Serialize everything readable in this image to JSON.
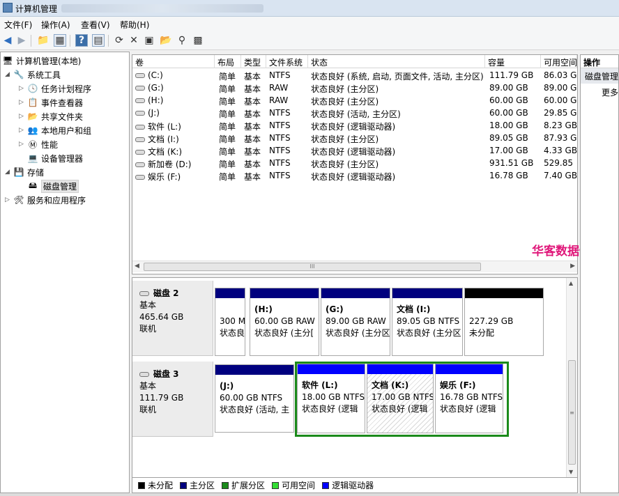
{
  "window": {
    "title": "计算机管理"
  },
  "menu": [
    "文件(F)",
    "操作(A)",
    "查看(V)",
    "帮助(H)"
  ],
  "toolbar_icons": [
    "back-arrow-icon",
    "forward-arrow-icon",
    "up-folder-icon",
    "console-tree-icon",
    "help-icon",
    "show-pane-icon",
    "refresh-icon",
    "delete-icon",
    "properties-icon",
    "open-icon",
    "search-icon",
    "export-icon"
  ],
  "tree": {
    "root": "计算机管理(本地)",
    "system_tools": "系统工具",
    "task_scheduler": "任务计划程序",
    "event_viewer": "事件查看器",
    "shared_folders": "共享文件夹",
    "local_users": "本地用户和组",
    "performance": "性能",
    "device_manager": "设备管理器",
    "storage": "存储",
    "disk_management": "磁盘管理",
    "services_apps": "服务和应用程序"
  },
  "volumes": {
    "columns": [
      "卷",
      "布局",
      "类型",
      "文件系统",
      "状态",
      "容量",
      "可用空间"
    ],
    "rows": [
      [
        "(C:)",
        "简单",
        "基本",
        "NTFS",
        "状态良好 (系统, 启动, 页面文件, 活动, 主分区)",
        "111.79 GB",
        "86.03 G"
      ],
      [
        "(G:)",
        "简单",
        "基本",
        "RAW",
        "状态良好 (主分区)",
        "89.00 GB",
        "89.00 G"
      ],
      [
        "(H:)",
        "简单",
        "基本",
        "RAW",
        "状态良好 (主分区)",
        "60.00 GB",
        "60.00 G"
      ],
      [
        "(J:)",
        "简单",
        "基本",
        "NTFS",
        "状态良好 (活动, 主分区)",
        "60.00 GB",
        "29.85 G"
      ],
      [
        "软件 (L:)",
        "简单",
        "基本",
        "NTFS",
        "状态良好 (逻辑驱动器)",
        "18.00 GB",
        "8.23 GB"
      ],
      [
        "文档 (I:)",
        "简单",
        "基本",
        "NTFS",
        "状态良好 (主分区)",
        "89.05 GB",
        "87.93 G"
      ],
      [
        "文档 (K:)",
        "简单",
        "基本",
        "NTFS",
        "状态良好 (逻辑驱动器)",
        "17.00 GB",
        "4.33 GB"
      ],
      [
        "新加卷 (D:)",
        "简单",
        "基本",
        "NTFS",
        "状态良好 (主分区)",
        "931.51 GB",
        "529.85 "
      ],
      [
        "娱乐 (F:)",
        "简单",
        "基本",
        "NTFS",
        "状态良好 (逻辑驱动器)",
        "16.78 GB",
        "7.40 GB"
      ]
    ]
  },
  "watermark": "华客数据恢复",
  "disks": [
    {
      "name": "磁盘 2",
      "type": "基本",
      "size": "465.64 GB",
      "status": "联机",
      "partitions": [
        {
          "name": "",
          "size": "300 M",
          "status": "状态良",
          "color": "#00007f"
        },
        {
          "name": "(H:)",
          "size": "60.00 GB RAW",
          "status": "状态良好 (主分[",
          "color": "#00007f"
        },
        {
          "name": "(G:)",
          "size": "89.00 GB RAW",
          "status": "状态良好 (主分区",
          "color": "#00007f"
        },
        {
          "name": "文档 (I:)",
          "size": "89.05 GB NTFS",
          "status": "状态良好 (主分区",
          "color": "#00007f"
        },
        {
          "name": "",
          "size": "227.29 GB",
          "status": "未分配",
          "color": "#000000"
        }
      ]
    },
    {
      "name": "磁盘 3",
      "type": "基本",
      "size": "111.79 GB",
      "status": "联机",
      "partitions": [
        {
          "name": "(J:)",
          "size": "60.00 GB NTFS",
          "status": "状态良好 (活动, 主",
          "color": "#00007f"
        },
        {
          "name": "软件 (L:)",
          "size": "18.00 GB NTFS",
          "status": "状态良好 (逻辑",
          "color": "#0000ff"
        },
        {
          "name": "文档 (K:)",
          "size": "17.00 GB NTFS",
          "status": "状态良好 (逻辑",
          "color": "#0000ff"
        },
        {
          "name": "娱乐 (F:)",
          "size": "16.78 GB NTFS",
          "status": "状态良好 (逻辑",
          "color": "#0000ff"
        }
      ]
    }
  ],
  "legend": [
    {
      "label": "未分配",
      "color": "#000000"
    },
    {
      "label": "主分区",
      "color": "#00007f"
    },
    {
      "label": "扩展分区",
      "color": "#1b8a1b"
    },
    {
      "label": "可用空间",
      "color": "#33dd33"
    },
    {
      "label": "逻辑驱动器",
      "color": "#0000ff"
    }
  ],
  "actions": {
    "header": "操作",
    "section": "磁盘管理",
    "more": "更多"
  },
  "scrollbar_grip": "III",
  "scrollbar_grip_v": "≡"
}
